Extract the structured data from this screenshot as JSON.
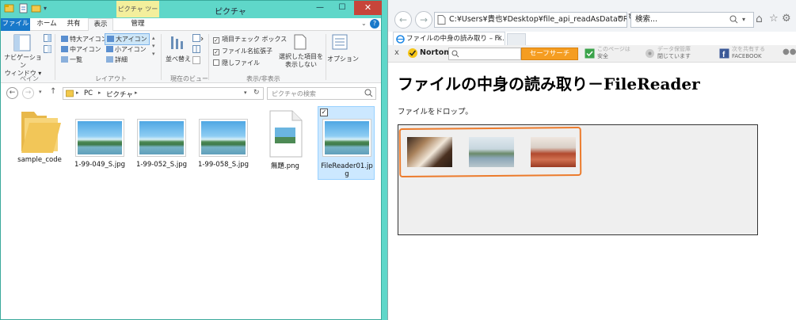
{
  "explorer": {
    "title": "ピクチャ",
    "context_tab": "ピクチャ ツール",
    "window_buttons": {
      "minimize": "—",
      "maximize": "☐",
      "close": "✕"
    },
    "tabs": [
      "ファイル",
      "ホーム",
      "共有",
      "表示",
      "管理"
    ],
    "ribbon": {
      "nav_pane": "ナビゲーション\nウィンドウ ▾",
      "pane_group": "ペイン",
      "layout_items": [
        "特大アイコン",
        "大アイコン",
        "中アイコン",
        "小アイコン",
        "一覧",
        "詳細"
      ],
      "layout_group": "レイアウト",
      "sort_label": "並べ替え",
      "view_group": "現在のビュー",
      "checks": [
        {
          "label": "項目チェック ボックス",
          "checked": true
        },
        {
          "label": "ファイル名拡張子",
          "checked": true
        },
        {
          "label": "隠しファイル",
          "checked": false
        }
      ],
      "hide_selected": "選択した項目を\n表示しない",
      "show_hide_group": "表示/非表示",
      "options": "オプション"
    },
    "address": {
      "crumbs": [
        "PC",
        "ピクチャ"
      ],
      "search_placeholder": "ピクチャの検索"
    },
    "files": [
      {
        "name": "sample_code",
        "type": "folder"
      },
      {
        "name": "1-99-049_S.jpg",
        "type": "image"
      },
      {
        "name": "1-99-052_S.jpg",
        "type": "image"
      },
      {
        "name": "1-99-058_S.jpg",
        "type": "image"
      },
      {
        "name": "無題.png",
        "type": "png"
      },
      {
        "name": "FileReader01.jpg",
        "type": "image",
        "selected": true
      }
    ]
  },
  "browser": {
    "url": "C:¥Users¥貴也¥Desktop¥file_api_readAsDataUR",
    "search_placeholder": "検索...",
    "tab_title": "ファイルの中身の読み取り – Fi...",
    "norton": {
      "brand": "Norton",
      "safe_search": "セーフサーチ",
      "page_safe_line1": "このページは",
      "page_safe_line2": "安全",
      "data_line1": "データ保管庫",
      "data_line2": "閉じています",
      "share_line1": "次を共有する",
      "share_line2": "FACEBOOK"
    },
    "page": {
      "heading": "ファイルの中身の読み取り－FileReader",
      "instruction": "ファイルをドロップ。"
    },
    "colors": {
      "highlight": "#ec7b2c",
      "norton_orange": "#f59d21"
    }
  }
}
